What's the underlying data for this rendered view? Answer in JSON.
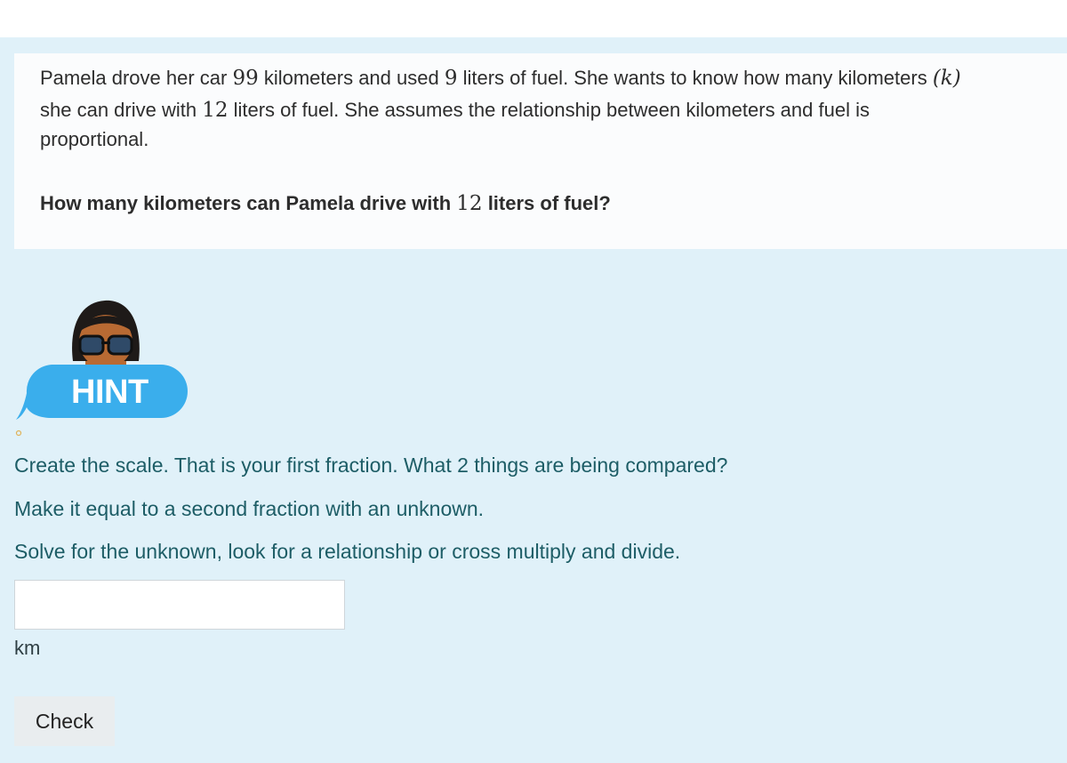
{
  "problem": {
    "line1_a": "Pamela drove her car ",
    "km_value": "99",
    "line1_b": " kilometers and used ",
    "fuel_value": "9",
    "line1_c": " liters of fuel. She wants to know how many kilometers ",
    "var_k": "(k)",
    "line2_a": "she can drive with ",
    "target_value": "12",
    "line2_b": " liters of fuel. She assumes the relationship between kilometers and fuel is",
    "line3": "proportional.",
    "question_a": "How many kilometers can Pamela drive with ",
    "question_value": "12",
    "question_b": " liters of fuel?"
  },
  "hint": {
    "label": "HINT",
    "lines": [
      "Create the scale. That is your first fraction. What 2 things are being compared?",
      "Make it equal to a second fraction with an unknown.",
      "Solve for the unknown, look for a relationship or cross multiply and divide."
    ]
  },
  "answer": {
    "value": "",
    "placeholder": "",
    "unit": "km"
  },
  "check_button": {
    "label": "Check"
  },
  "colors": {
    "panel_bg": "#e0f1f9",
    "bubble": "#3aaeec",
    "hint_text": "#1d5d66"
  },
  "icons": {
    "avatar": "avatar-icon",
    "bubble": "speech-bubble-icon",
    "dot": "small-circle-icon"
  }
}
